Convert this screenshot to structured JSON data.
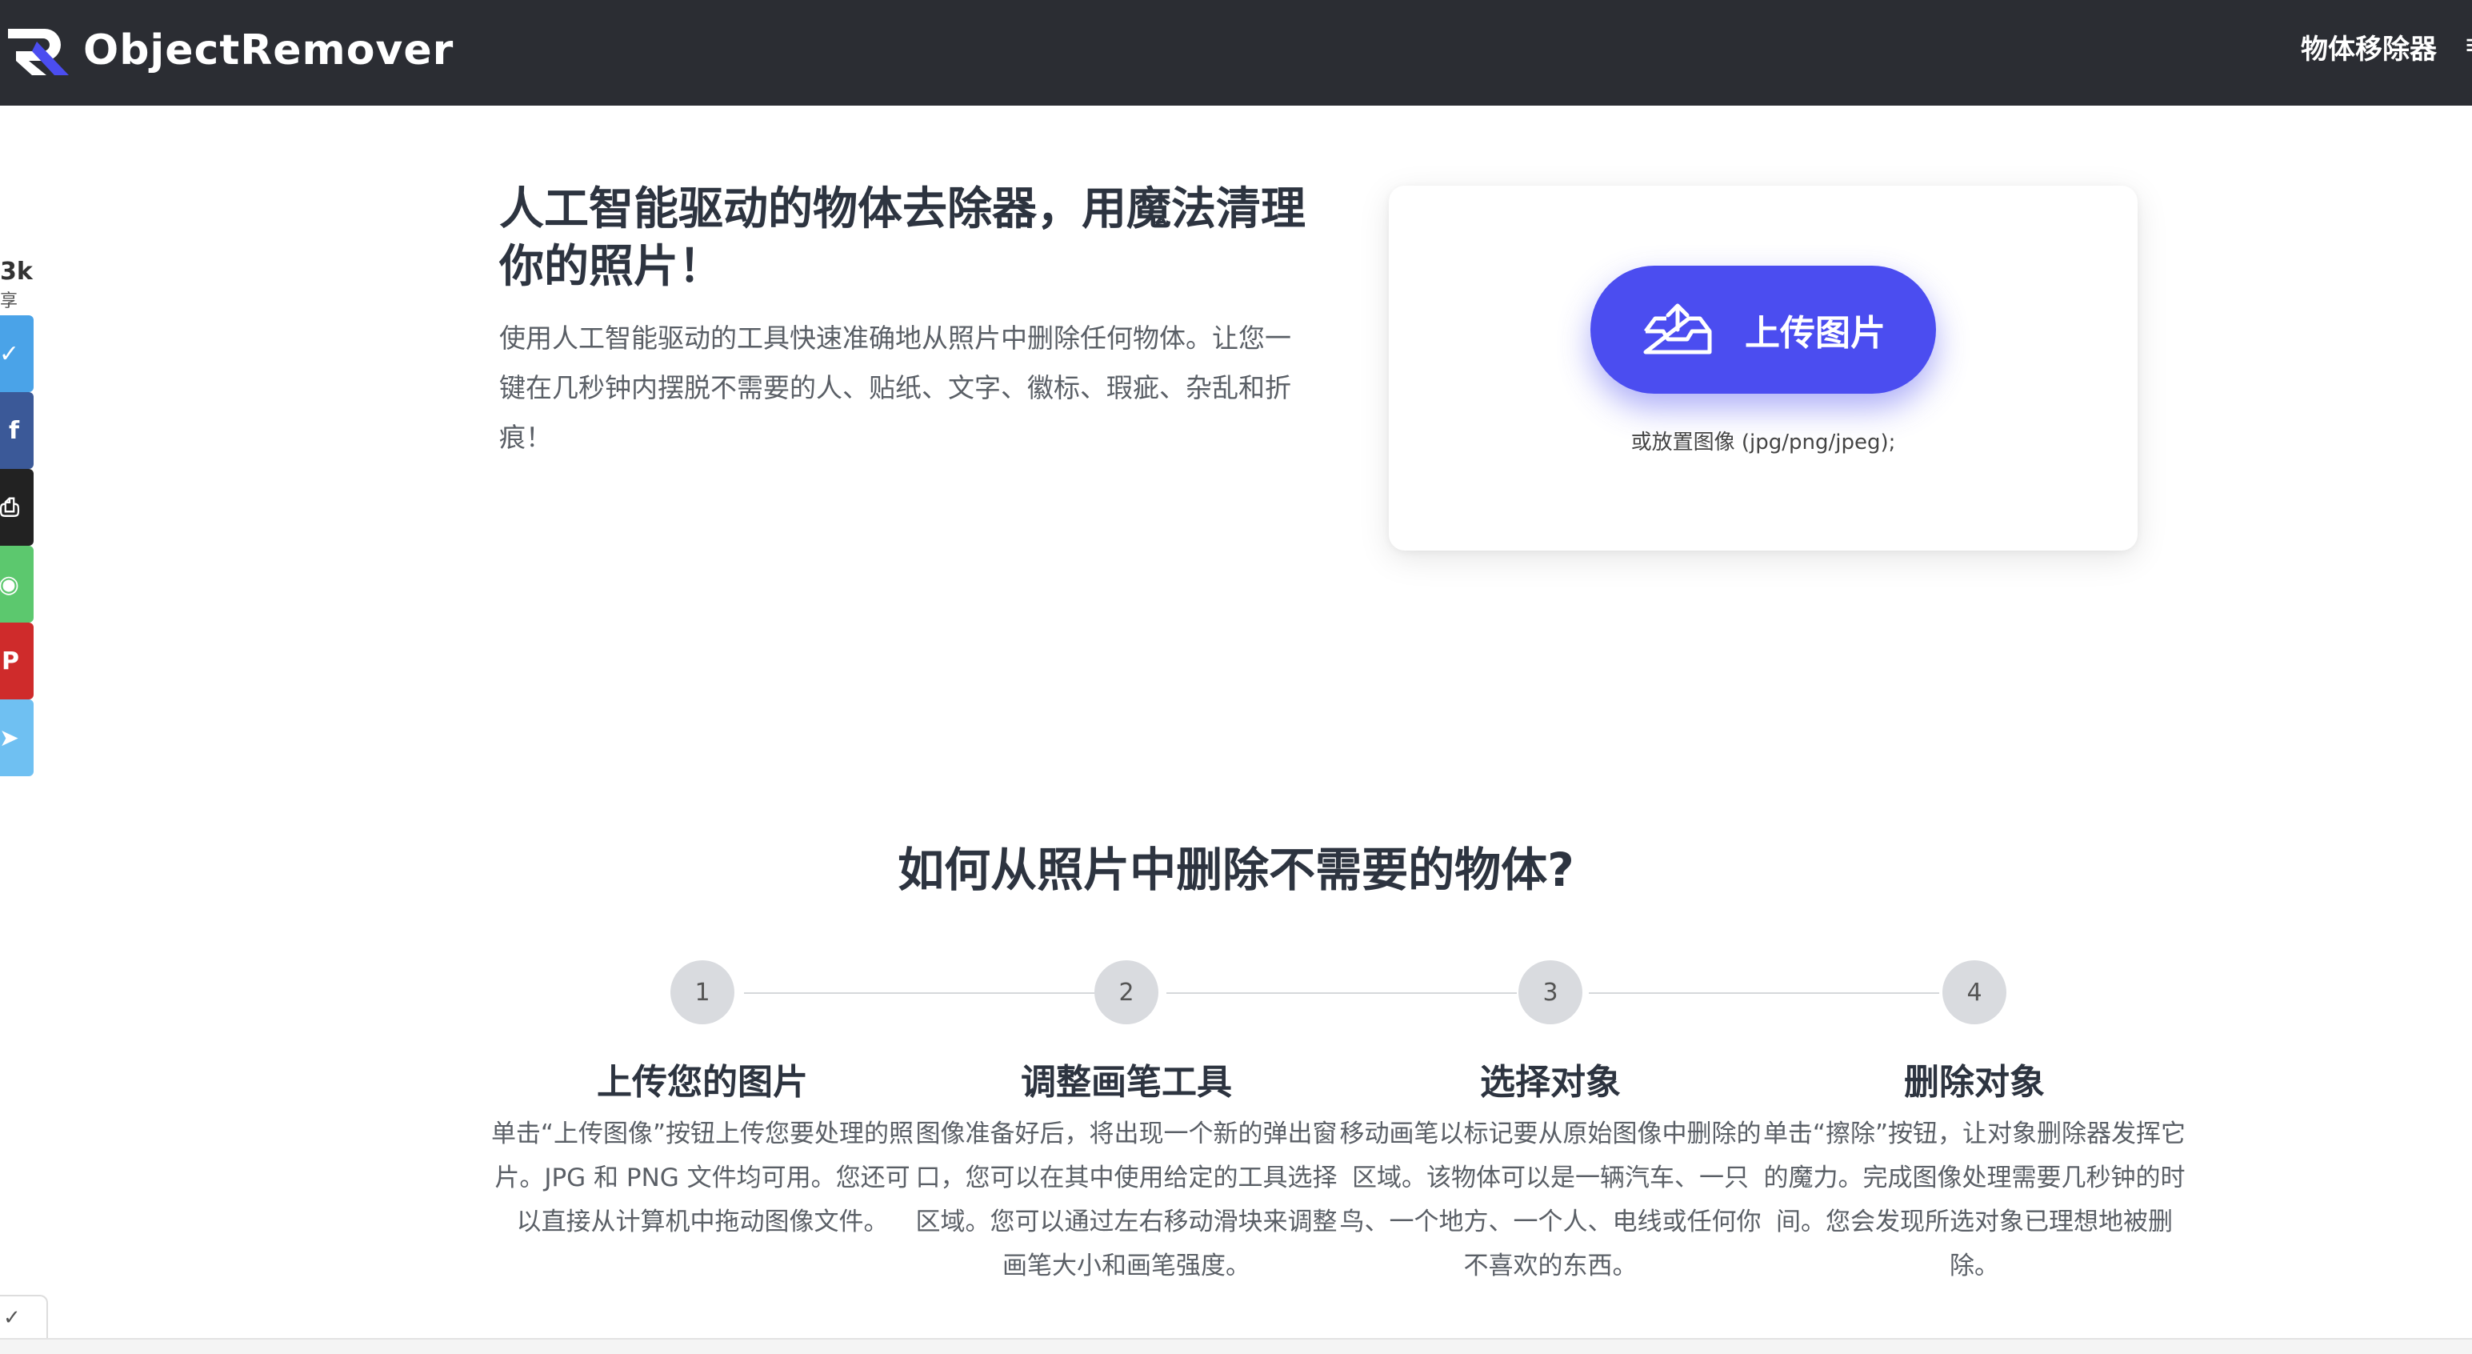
{
  "header": {
    "logo_text": "ObjectRemover",
    "nav_item": "物体移除器",
    "nav_partial": "≡"
  },
  "share": {
    "count": "3k",
    "label": "享",
    "buttons": [
      {
        "name": "twitter",
        "glyph": "✓",
        "color": "#4aa3e8"
      },
      {
        "name": "facebook",
        "glyph": "f",
        "color": "#3b5998"
      },
      {
        "name": "print",
        "glyph": "⎙",
        "color": "#222222"
      },
      {
        "name": "whatsapp",
        "glyph": "◉",
        "color": "#5cc86e"
      },
      {
        "name": "pinterest",
        "glyph": "P",
        "color": "#cf2b2b"
      },
      {
        "name": "telegram",
        "glyph": "➤",
        "color": "#6fc0f2"
      }
    ]
  },
  "hero": {
    "title": "人工智能驱动的物体去除器，用魔法清理你的照片！",
    "description": "使用人工智能驱动的工具快速准确地从照片中删除任何物体。让您一键在几秒钟内摆脱不需要的人、贴纸、文字、徽标、瑕疵、杂乱和折痕！"
  },
  "upload": {
    "button_label": "上传图片",
    "hint": "或放置图像 (jpg/png/jpeg);"
  },
  "howto": {
    "title": "如何从照片中删除不需要的物体?",
    "steps": [
      {
        "number": "1",
        "title": "上传您的图片",
        "desc": "单击“上传图像”按钮上传您要处理的照片。JPG 和 PNG 文件均可用。您还可以直接从计算机中拖动图像文件。"
      },
      {
        "number": "2",
        "title": "调整画笔工具",
        "desc": "图像准备好后，将出现一个新的弹出窗口，您可以在其中使用给定的工具选择区域。您可以通过左右移动滑块来调整画笔大小和画笔强度。"
      },
      {
        "number": "3",
        "title": "选择对象",
        "desc": "移动画笔以标记要从原始图像中删除的区域。该物体可以是一辆汽车、一只鸟、一个地方、一个人、电线或任何你不喜欢的东西。"
      },
      {
        "number": "4",
        "title": "删除对象",
        "desc": "单击“擦除”按钮，让对象删除器发挥它的魔力。完成图像处理需要几秒钟的时间。您会发现所选对象已理想地被删除。"
      }
    ]
  },
  "footer": {
    "tab_glyph": "✓"
  }
}
